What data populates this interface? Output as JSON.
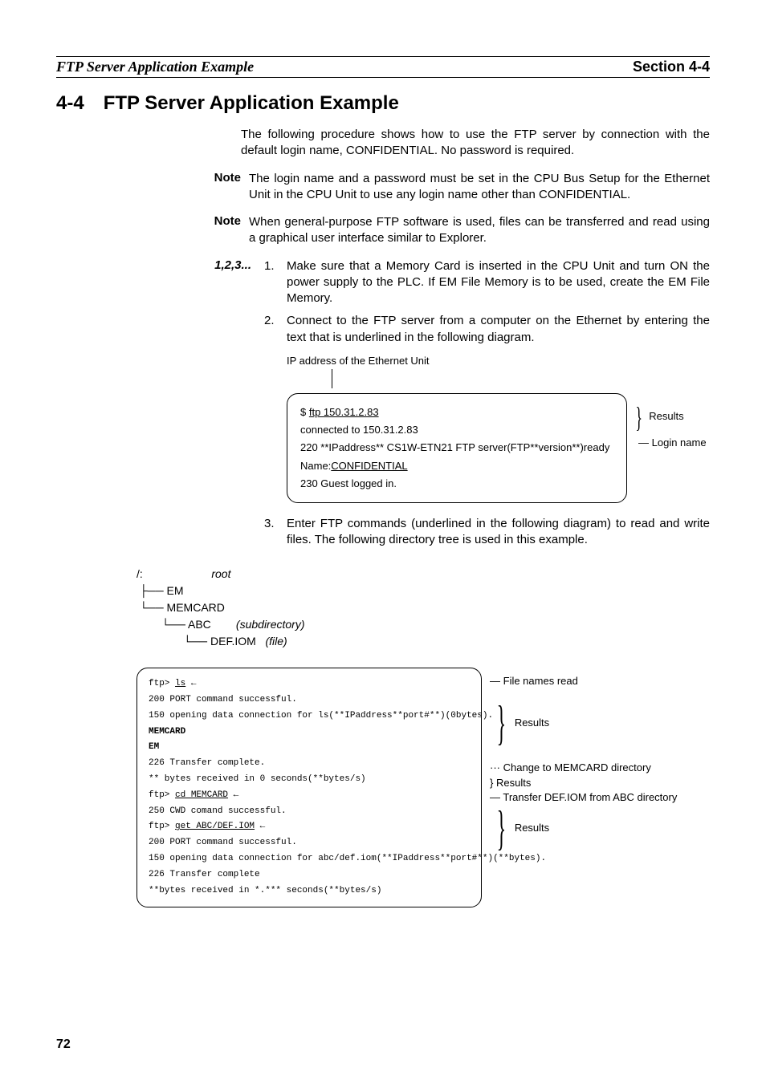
{
  "header": {
    "running_title": "FTP Server Application Example",
    "section_label": "Section 4-4"
  },
  "title": "4-4 FTP Server Application Example",
  "intro": "The following procedure shows how to use the FTP server by connection with the default login name, CONFIDENTIAL. No password is required.",
  "notes": [
    {
      "label": "Note",
      "text": "The login name and a password must be set in the CPU Bus Setup for the Ethernet Unit in the CPU Unit to use any login name other than CONFIDENTIAL."
    },
    {
      "label": "Note",
      "text": "When general-purpose FTP software is used, files can be transferred and read using a graphical user interface similar to Explorer."
    }
  ],
  "steps_label": "1,2,3...",
  "steps": [
    "Make sure that a Memory Card is inserted in the CPU Unit and turn ON the power supply to the PLC. If EM File Memory is to be used, create the EM File Memory.",
    "Connect to the FTP server from a computer on the Ethernet by entering the text that is underlined in the following diagram.",
    "Enter FTP commands (underlined in the following diagram) to read and write files. The following directory tree is used in this example."
  ],
  "diagram1": {
    "caption": "IP address of the Ethernet Unit",
    "lines": {
      "l1_prefix": "$ ",
      "l1_cmd": "ftp 150.31.2.83",
      "l2": "connected to 150.31.2.83",
      "l3": "220 **IPaddress** CS1W-ETN21 FTP server(FTP**version**)ready",
      "l4_prefix": "Name:",
      "l4_value": "CONFIDENTIAL",
      "l5": "230 Guest logged in."
    },
    "side": {
      "results": "Results",
      "login": "Login name"
    }
  },
  "tree": {
    "root_path": "/:",
    "root_label": "root",
    "em": "EM",
    "memcard": "MEMCARD",
    "abc": "ABC",
    "abc_label": "(subdirectory)",
    "def": "DEF.IOM",
    "def_label": "(file)"
  },
  "diagram2": {
    "lines": {
      "l1_prefix": "ftp> ",
      "l1_cmd": "ls",
      "l2": "200 PORT command successful.",
      "l3": "150 opening data connection for ls(**IPaddress**port#**)(0bytes).",
      "l4": "MEMCARD",
      "l5": "EM",
      "l6": "226 Transfer complete.",
      "l7": "** bytes received in 0 seconds(**bytes/s)",
      "l8_prefix": "ftp> ",
      "l8_cmd": "cd MEMCARD",
      "l9": "250 CWD comand successful.",
      "l10_prefix": "ftp> ",
      "l10_cmd": "get ABC/DEF.IOM",
      "l11": "200 PORT command successful.",
      "l12": "150 opening data connection for abc/def.iom(**IPaddress**port#**)(**bytes).",
      "l13": "226 Transfer complete",
      "l14": "**bytes received in *.*** seconds(**bytes/s)"
    },
    "side": {
      "file_names": "File names read",
      "results": "Results",
      "change_dir": "Change to MEMCARD directory",
      "transfer": "Transfer DEF.IOM from ABC directory"
    }
  },
  "page_number": "72"
}
